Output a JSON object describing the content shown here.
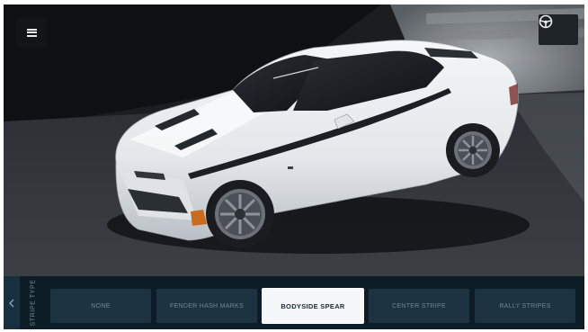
{
  "menu": {
    "icon": "hamburger-menu-icon"
  },
  "top_right": {
    "icon": "steering-wheel-icon"
  },
  "bottom_bar": {
    "back_icon": "chevron-left-icon",
    "section_label": "STRIPE TYPE",
    "options": [
      {
        "label": "NONE"
      },
      {
        "label": "FENDER HASH MARKS"
      },
      {
        "label": "BODYSIDE SPEAR"
      },
      {
        "label": "CENTER STRIPE"
      },
      {
        "label": "RALLY STRIPES"
      }
    ],
    "selected_label": "BODYSIDE SPEAR"
  },
  "colors": {
    "car_body": "#e9ecee",
    "stripe": "#1c2024",
    "bar_background": "#0d1d27",
    "option_background": "#1d3341",
    "selected_background": "#f6f7f8"
  }
}
